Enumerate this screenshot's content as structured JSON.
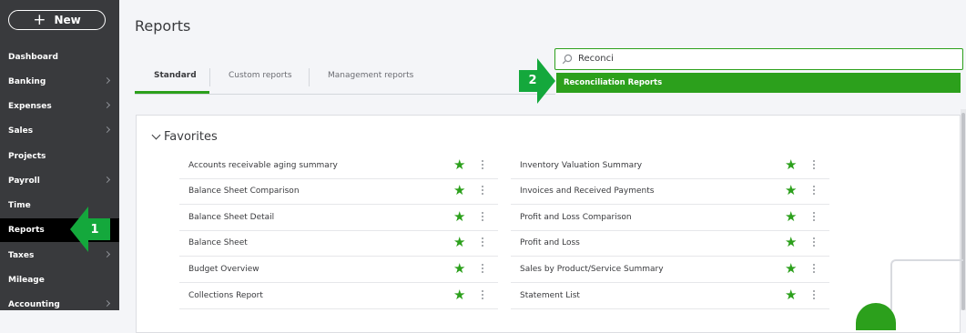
{
  "app": {
    "new_label": "New"
  },
  "sidebar": {
    "items": [
      {
        "label": "Dashboard",
        "chevron": false
      },
      {
        "label": "Banking",
        "chevron": true
      },
      {
        "label": "Expenses",
        "chevron": true
      },
      {
        "label": "Sales",
        "chevron": true
      },
      {
        "label": "Projects",
        "chevron": false
      },
      {
        "label": "Payroll",
        "chevron": true
      },
      {
        "label": "Time",
        "chevron": false
      },
      {
        "label": "Reports",
        "chevron": false,
        "active": true
      },
      {
        "label": "Taxes",
        "chevron": true
      },
      {
        "label": "Mileage",
        "chevron": false
      },
      {
        "label": "Accounting",
        "chevron": true
      }
    ]
  },
  "header": {
    "title": "Reports"
  },
  "tabs": [
    {
      "label": "Standard",
      "active": true
    },
    {
      "label": "Custom reports",
      "active": false
    },
    {
      "label": "Management reports",
      "active": false
    }
  ],
  "search": {
    "value": "Reconci",
    "icon": "search-icon"
  },
  "dropdown": {
    "result": "Reconciliation Reports"
  },
  "favorites": {
    "title": "Favorites",
    "left": [
      {
        "label": "Accounts receivable aging summary"
      },
      {
        "label": "Balance Sheet Comparison"
      },
      {
        "label": "Balance Sheet Detail"
      },
      {
        "label": "Balance Sheet"
      },
      {
        "label": "Budget Overview"
      },
      {
        "label": "Collections Report"
      }
    ],
    "right": [
      {
        "label": "Inventory Valuation Summary"
      },
      {
        "label": "Invoices and Received Payments"
      },
      {
        "label": "Profit and Loss Comparison"
      },
      {
        "label": "Profit and Loss"
      },
      {
        "label": "Sales by Product/Service Summary"
      },
      {
        "label": "Statement List"
      }
    ]
  },
  "callouts": {
    "one": "1",
    "two": "2"
  },
  "colors": {
    "accent": "#2ca01c",
    "sidebar": "#393a3d",
    "callout": "#14a83c"
  }
}
